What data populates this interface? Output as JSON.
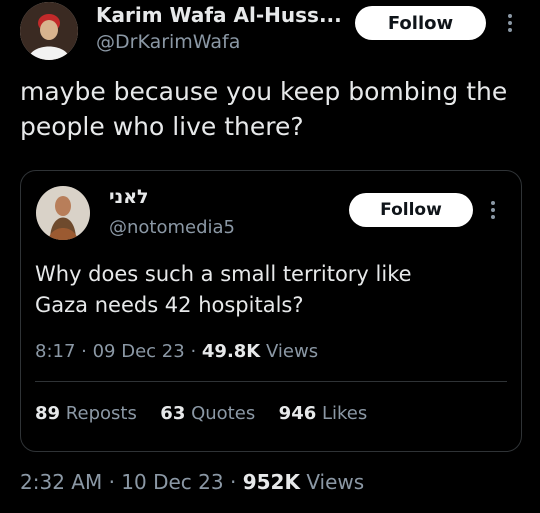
{
  "tweet": {
    "author_name": "Karim Wafa Al-Huss...",
    "author_handle": "@DrKarimWafa",
    "follow_label": "Follow",
    "text": "maybe because you keep bombing the people who live there?",
    "time": "2:32 AM",
    "date": "10 Dec 23",
    "views_count": "952K",
    "views_label": "Views"
  },
  "quoted": {
    "author_name": "לאני",
    "author_handle": "@notomedia5",
    "follow_label": "Follow",
    "text": "Why does such a small territory like Gaza needs 42 hospitals?",
    "time": "8:17",
    "date": "09 Dec 23",
    "views_count": "49.8K",
    "views_label": "Views",
    "stats": {
      "reposts_count": "89",
      "reposts_label": "Reposts",
      "quotes_count": "63",
      "quotes_label": "Quotes",
      "likes_count": "946",
      "likes_label": "Likes"
    }
  },
  "colors": {
    "background": "#000000",
    "text": "#e7e9ea",
    "muted": "#8b98a5",
    "border": "#2f3336",
    "button_bg": "#ffffff"
  },
  "icons": {
    "more": "more-vertical-icon"
  }
}
